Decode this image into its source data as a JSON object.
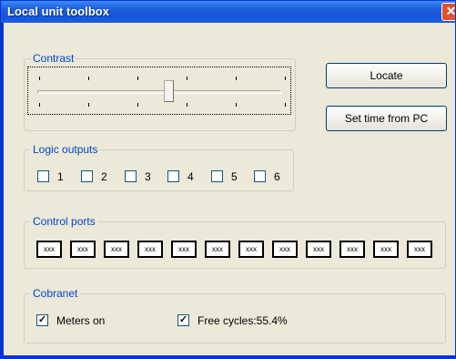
{
  "window": {
    "title": "Local unit toolbox",
    "close_glyph": "✕"
  },
  "contrast": {
    "label": "Contrast",
    "level_fraction": 0.54
  },
  "buttons": {
    "locate": "Locate",
    "set_time": "Set time from PC"
  },
  "logic_outputs": {
    "label": "Logic outputs",
    "items": [
      {
        "label": "1",
        "checked": false
      },
      {
        "label": "2",
        "checked": false
      },
      {
        "label": "3",
        "checked": false
      },
      {
        "label": "4",
        "checked": false
      },
      {
        "label": "5",
        "checked": false
      },
      {
        "label": "6",
        "checked": false
      }
    ]
  },
  "control_ports": {
    "label": "Control ports",
    "ports": [
      "xxx",
      "xxx",
      "xxx",
      "xxx",
      "xxx",
      "xxx",
      "xxx",
      "xxx",
      "xxx",
      "xxx",
      "xxx",
      "xxx"
    ]
  },
  "cobranet": {
    "label": "Cobranet",
    "meters_on": {
      "label": "Meters on",
      "checked": true
    },
    "free_cycles": {
      "label": "Free cycles:55.4%",
      "checked": true
    }
  }
}
